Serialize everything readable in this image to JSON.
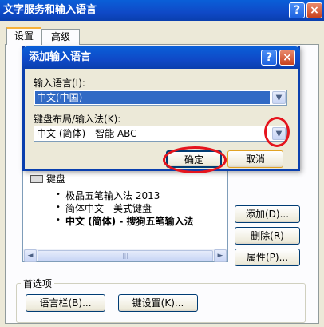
{
  "window": {
    "title": "文字服务和输入语言",
    "help_glyph": "?",
    "close_glyph": "×"
  },
  "tabs": [
    {
      "label": "设置",
      "active": true
    },
    {
      "label": "高级",
      "active": false
    }
  ],
  "installed_services": {
    "category": "键盘",
    "items": [
      "极品五笔输入法 2013",
      "简体中文 - 美式键盘",
      "中文 (简体) - 搜狗五笔输入法"
    ],
    "bold_item_index": 2,
    "bullet": "•",
    "scrollbar": {
      "left_glyph": "◄",
      "right_glyph": "►",
      "grip": "|||"
    }
  },
  "service_buttons": {
    "add": "添加(D)...",
    "remove": "删除(R)",
    "properties": "属性(P)..."
  },
  "preferences": {
    "label": "首选项",
    "language_bar_button": "语言栏(B)...",
    "key_settings_button": "键设置(K)..."
  },
  "add_language_dialog": {
    "title": "添加输入语言",
    "input_language_label": "输入语言(I):",
    "input_language_value": "中文(中国)",
    "keyboard_layout_label": "键盘布局/输入法(K):",
    "keyboard_layout_value": "中文 (简体) - 智能 ABC",
    "ok_button": "确定",
    "cancel_button": "取消",
    "dropdown_glyph": "▼"
  },
  "colors": {
    "titlebar": "#0a3fae",
    "selection": "#316ac5",
    "annotation_red": "#e5141d"
  }
}
